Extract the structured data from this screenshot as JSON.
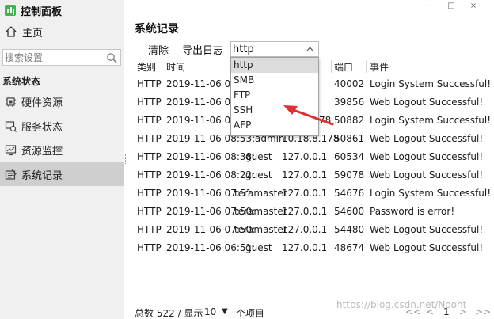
{
  "app": {
    "title": "控制面板"
  },
  "window": {
    "minimize": "–",
    "maximize": "□",
    "close": "×"
  },
  "sidebar": {
    "home": "主页",
    "search_placeholder": "搜索设置",
    "section": "系统状态",
    "items": [
      {
        "label": "硬件资源",
        "icon": "chip-icon"
      },
      {
        "label": "服务状态",
        "icon": "service-icon"
      },
      {
        "label": "资源监控",
        "icon": "monitor-icon"
      },
      {
        "label": "系统记录",
        "icon": "log-icon",
        "active": true
      }
    ]
  },
  "main": {
    "title": "系统记录",
    "clear": "清除",
    "export": "导出日志",
    "filter": {
      "value": "http",
      "options": [
        "http",
        "SMB",
        "FTP",
        "SSH",
        "AFP"
      ],
      "selected_index": 3
    },
    "columns": {
      "type": "类别",
      "time": "时间",
      "port": "端口",
      "event": "事件"
    },
    "rows": [
      {
        "type": "HTTP",
        "time": "2019-11-06 09:",
        "user": "",
        "ip": "",
        "port": "40002",
        "event": "Login System Successful!"
      },
      {
        "type": "HTTP",
        "time": "2019-11-06 09:",
        "user": "",
        "ip": "",
        "port": "39856",
        "event": "Web Logout Successful!"
      },
      {
        "type": "HTTP",
        "time": "2019-11-06 08:",
        "user": "",
        "ip": "78",
        "port": "50882",
        "event": "Login System Successful!"
      },
      {
        "type": "HTTP",
        "time": "2019-11-06 08:53:",
        "user": "admin",
        "ip": "10.18.8.178",
        "port": "50861",
        "event": "Web Logout Successful!"
      },
      {
        "type": "HTTP",
        "time": "2019-11-06 08:38:",
        "user": "guest",
        "ip": "127.0.0.1",
        "port": "60534",
        "event": "Web Logout Successful!"
      },
      {
        "type": "HTTP",
        "time": "2019-11-06 08:22:",
        "user": "guest",
        "ip": "127.0.0.1",
        "port": "59078",
        "event": "Web Logout Successful!"
      },
      {
        "type": "HTTP",
        "time": "2019-11-06 07:51",
        "user": "teramaster",
        "ip": "127.0.0.1",
        "port": "54676",
        "event": "Login System Successful!"
      },
      {
        "type": "HTTP",
        "time": "2019-11-06 07:50:",
        "user": "teramaster",
        "ip": "127.0.0.1",
        "port": "54600",
        "event": "Password is error!"
      },
      {
        "type": "HTTP",
        "time": "2019-11-06 07:50:",
        "user": "teramaster",
        "ip": "127.0.0.1",
        "port": "54480",
        "event": "Web Logout Successful!"
      },
      {
        "type": "HTTP",
        "time": "2019-11-06 06:51:",
        "user": "guest",
        "ip": "127.0.0.1",
        "port": "48674",
        "event": "Web Logout Successful!"
      }
    ]
  },
  "footer": {
    "total_label": "总数 522 / 显示",
    "page_size": "10",
    "page_size_arrow": "▼",
    "items_suffix": "个项目",
    "first": "<<",
    "prev": "<",
    "page": "1",
    "next": ">",
    "last": ">>"
  },
  "watermark": "https://blog.csdn.net/Noont",
  "colors": {
    "accent_green": "#3fb34f",
    "arrow_red": "#e03030",
    "active_nav": "#cfcfcf"
  }
}
